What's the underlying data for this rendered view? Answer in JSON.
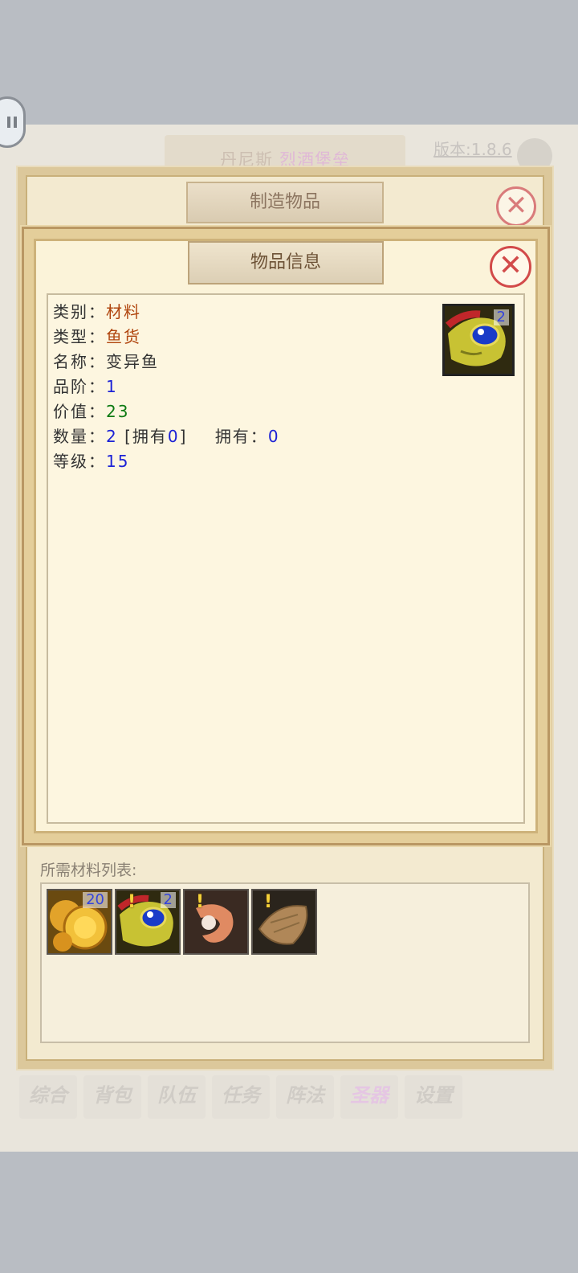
{
  "background": {
    "location_name": "丹尼斯",
    "location_sub": "烈酒堡垒",
    "version": "版本:1.8.6",
    "bottom_tabs": [
      "综合",
      "背包",
      "队伍",
      "任务",
      "阵法",
      "圣器",
      "设置"
    ]
  },
  "craft_window": {
    "title": "制造物品",
    "close_icon": "close-icon",
    "materials_label": "所需材料列表:",
    "materials": [
      {
        "icon": "gold-coins-icon",
        "count": "20",
        "warning": false
      },
      {
        "icon": "mutant-fish-icon",
        "count": "2",
        "warning": true
      },
      {
        "icon": "shrimp-icon",
        "count": "",
        "warning": true
      },
      {
        "icon": "sack-icon",
        "count": "",
        "warning": true
      }
    ]
  },
  "item_info": {
    "title": "物品信息",
    "close_icon": "close-icon",
    "icon": "mutant-fish-icon",
    "icon_count": "2",
    "category_label": "类别：",
    "category": "材料",
    "type_label": "类型：",
    "type": "鱼货",
    "name_label": "名称：",
    "name": "变异鱼",
    "grade_label": "品阶：",
    "grade": "1",
    "value_label": "价值：",
    "value": "23",
    "quantity_label": "数量：",
    "quantity": "2",
    "owned_open": "[拥有",
    "owned_bracket_value": "0",
    "owned_close": "]",
    "owned_label": "拥有：",
    "owned": "0",
    "level_label": "等级：",
    "level": "15"
  }
}
